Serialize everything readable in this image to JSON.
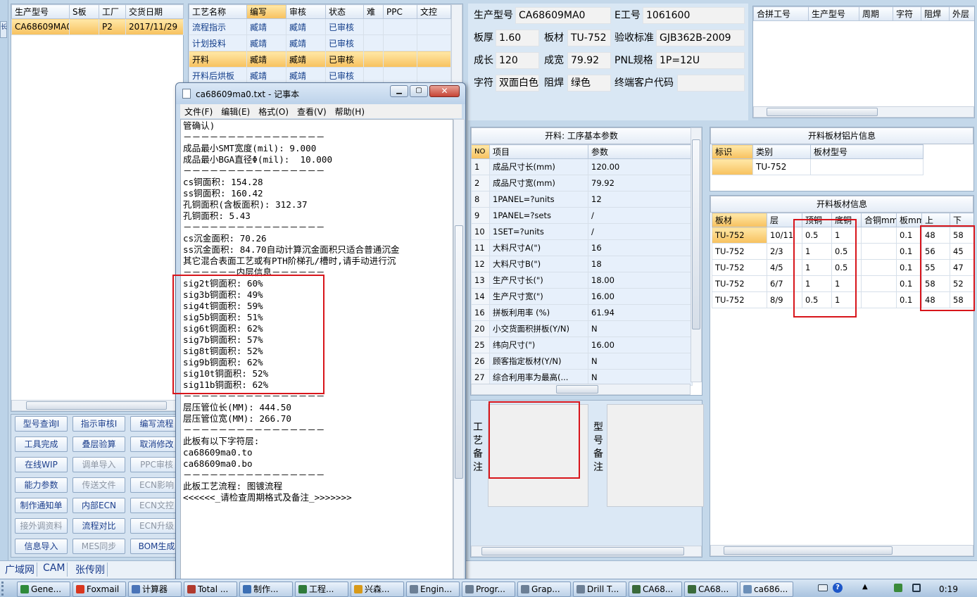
{
  "left_grid": {
    "headers": [
      "生产型号",
      "S板",
      "工厂",
      "交货日期"
    ],
    "rows": [
      [
        "CA68609MA0",
        "",
        "P2",
        "2017/11/29"
      ]
    ]
  },
  "process_grid": {
    "headers": [
      "工艺名称",
      "编写",
      "审核",
      "状态",
      "难",
      "PPC",
      "文控"
    ],
    "rows": [
      [
        "流程指示",
        "臧靖",
        "臧靖",
        "已审核",
        "",
        "",
        ""
      ],
      [
        "计划投料",
        "臧靖",
        "臧靖",
        "已审核",
        "",
        "",
        ""
      ],
      [
        "开料",
        "臧靖",
        "臧靖",
        "已审核",
        "",
        "",
        ""
      ],
      [
        "开料后烘板",
        "臧靖",
        "臧靖",
        "已审核",
        "",
        "",
        ""
      ]
    ]
  },
  "buttons": [
    [
      "型号查询I",
      "指示审核I",
      "编写流程"
    ],
    [
      "工具完成",
      "叠层验算",
      "取消修改"
    ],
    [
      "在线WIP",
      "调单导入",
      "PPC审核"
    ],
    [
      "能力参数",
      "传送文件",
      "ECN影响"
    ],
    [
      "制作通知单",
      "内部ECN",
      "ECN文控"
    ],
    [
      "接外调资料",
      "流程对比",
      "ECN升级"
    ],
    [
      "信息导入",
      "MES同步",
      "BOM生成"
    ]
  ],
  "status_tabs": [
    "广域网",
    "CAM",
    "张传刚"
  ],
  "info": {
    "model_label": "生产型号",
    "model": "CA68609MA0",
    "eno_label": "E工号",
    "eno": "1061600",
    "thick_label": "板厚",
    "thick": "1.60",
    "material_label": "板材",
    "material": "TU-752",
    "std_label": "验收标准",
    "std": "GJB362B-2009",
    "len_label": "成长",
    "len": "120",
    "wid_label": "成宽",
    "wid": "79.92",
    "pnl_label": "PNL规格",
    "pnl": "1P=12U",
    "char_label": "字符",
    "char": "双面白色",
    "mask_label": "阻焊",
    "mask": "绿色",
    "customer_label": "终端客户代码",
    "customer": ""
  },
  "combine_grid": {
    "headers": [
      "合拼工号",
      "生产型号",
      "周期",
      "字符",
      "阻焊",
      "外层"
    ]
  },
  "params": {
    "title": "开料: 工序基本参数",
    "headers": [
      "NO",
      "项目",
      "参数"
    ],
    "rows": [
      [
        "1",
        "成品尺寸长(mm)",
        "120.00"
      ],
      [
        "2",
        "成品尺寸宽(mm)",
        "79.92"
      ],
      [
        "8",
        "1PANEL=?units",
        "12"
      ],
      [
        "9",
        "1PANEL=?sets",
        "/"
      ],
      [
        "10",
        "1SET=?units",
        "/"
      ],
      [
        "11",
        "大料尺寸A(\")",
        "16"
      ],
      [
        "12",
        "大料尺寸B(\")",
        "18"
      ],
      [
        "13",
        "生产尺寸长(\")",
        "18.00"
      ],
      [
        "14",
        "生产尺寸宽(\")",
        "16.00"
      ],
      [
        "16",
        "拼板利用率 (%)",
        "61.94"
      ],
      [
        "20",
        "小交货面积拼板(Y/N)",
        "N"
      ],
      [
        "25",
        "纬向尺寸(\")",
        "16.00"
      ],
      [
        "26",
        "顾客指定板材(Y/N)",
        "N"
      ],
      [
        "27",
        "综合利用率为最高(...",
        "N"
      ]
    ]
  },
  "copper_sheet": {
    "title": "开料板材铝片信息",
    "headers": [
      "标识",
      "类别",
      "板材型号"
    ],
    "rows": [
      [
        "",
        "TU-752",
        ""
      ]
    ]
  },
  "material_info": {
    "title": "开料板材信息",
    "headers": [
      "板材",
      "层",
      "顶铜",
      "底铜",
      "合铜mm",
      "板mm",
      "上",
      "下"
    ],
    "rows": [
      [
        "TU-752",
        "10/11",
        "0.5",
        "1",
        "",
        "0.1",
        "48",
        "58"
      ],
      [
        "TU-752",
        "2/3",
        "1",
        "0.5",
        "",
        "0.1",
        "56",
        "45"
      ],
      [
        "TU-752",
        "4/5",
        "1",
        "0.5",
        "",
        "0.1",
        "55",
        "47"
      ],
      [
        "TU-752",
        "6/7",
        "1",
        "1",
        "",
        "0.1",
        "58",
        "52"
      ],
      [
        "TU-752",
        "8/9",
        "0.5",
        "1",
        "",
        "0.1",
        "48",
        "58"
      ]
    ]
  },
  "remarks": {
    "process_label": "工艺备注",
    "model_label": "型号备注"
  },
  "notepad": {
    "title": "ca68609ma0.txt - 记事本",
    "menu": [
      "文件(F)",
      "编辑(E)",
      "格式(O)",
      "查看(V)",
      "帮助(H)"
    ],
    "lines": [
      "管确认)",
      "－－－－－－－－－－－－－－－－",
      "成品最小SMT宽度(mil): 9.000",
      "成品最小BGA直径Φ(mil):  10.000",
      "－－－－－－－－－－－－－－－－",
      "cs铜面积: 154.28",
      "ss铜面积: 160.42",
      "孔铜面积(含板面积): 312.37",
      "孔铜面积: 5.43",
      "－－－－－－－－－－－－－－－－",
      "cs沉金面积: 70.26",
      "ss沉金面积: 84.70自动计算沉金面积只适合普通沉金",
      "其它混合表面工艺或有PTH阶梯孔/槽时,请手动进行沉",
      "－－－－－－内层信息－－－－－－",
      "sig2t铜面积: 60%",
      "sig3b铜面积: 49%",
      "sig4t铜面积: 59%",
      "sig5b铜面积: 51%",
      "sig6t铜面积: 62%",
      "sig7b铜面积: 57%",
      "sig8t铜面积: 52%",
      "sig9b铜面积: 62%",
      "sig10t铜面积: 52%",
      "sig11b铜面积: 62%",
      "－－－－－－－－－－－－－－－－",
      "层压管位长(MM): 444.50",
      "层压管位宽(MM): 266.70",
      "－－－－－－－－－－－－－－－－",
      "此板有以下字符层:",
      "ca68609ma0.to",
      "ca68609ma0.bo",
      "－－－－－－－－－－－－－－－－",
      "此板工艺流程: 图镀流程",
      "<<<<<<_请检查周期格式及备注_>>>>>>>"
    ]
  },
  "taskbar": {
    "items": [
      "Gene...",
      "Foxmail",
      "计算器",
      "Total ...",
      "制作...",
      "工程...",
      "兴森...",
      "Engin...",
      "Progr...",
      "Grap...",
      "Drill T...",
      "CA68...",
      "CA68...",
      "ca686..."
    ],
    "clock": "0:19"
  }
}
